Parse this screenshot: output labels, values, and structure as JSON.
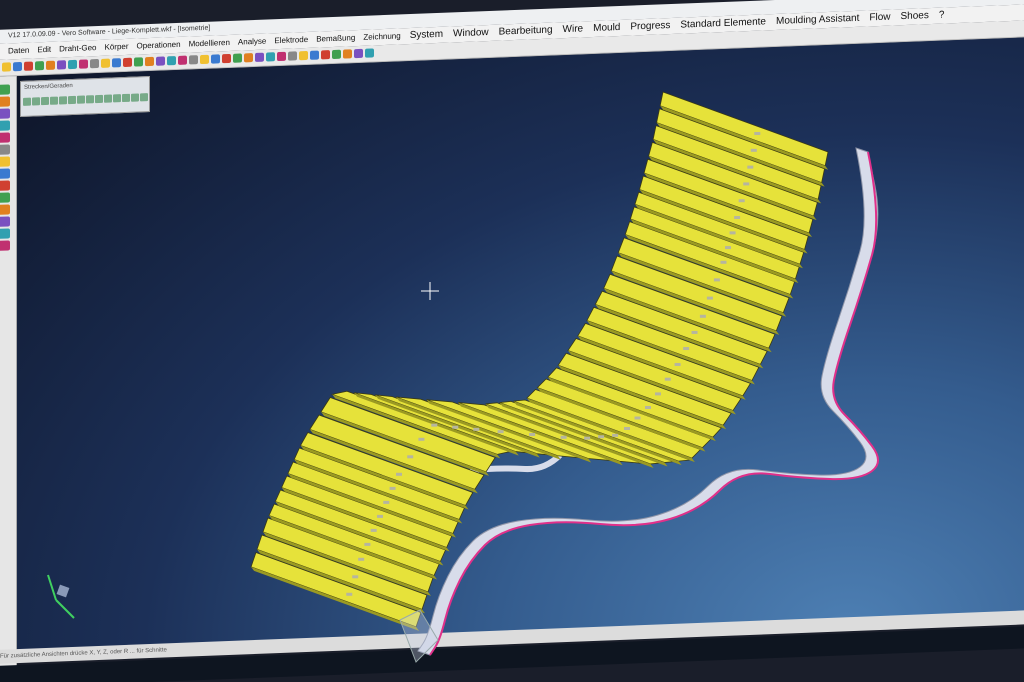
{
  "window": {
    "title": "V12 17.0.09.09 - Vero Software - Liege-Komplett.wkf - [Isometrie]"
  },
  "menu": [
    "Daten",
    "Edit",
    "Draht-Geo",
    "Körper",
    "Operationen",
    "Modellieren",
    "Analyse",
    "Elektrode",
    "Bemaßung",
    "Zeichnung",
    "System",
    "Window",
    "Bearbeitung",
    "Wire",
    "Mould",
    "Progress",
    "Standard Elemente",
    "Moulding Assistant",
    "Flow",
    "Shoes",
    "?"
  ],
  "float_panel": {
    "title": "Strecken/Geraden"
  },
  "status": {
    "prompt": "Für zusätzliche Ansichten drücke X, Y, Z, oder R ... für Schnitte"
  },
  "colors": {
    "slat": "#e6e23a",
    "slat_dark": "#9b9a22",
    "frame": "#d8dcea",
    "outline": "#e0308a",
    "bg_top": "#0e1528",
    "bg_bottom": "#4d7fb3"
  }
}
